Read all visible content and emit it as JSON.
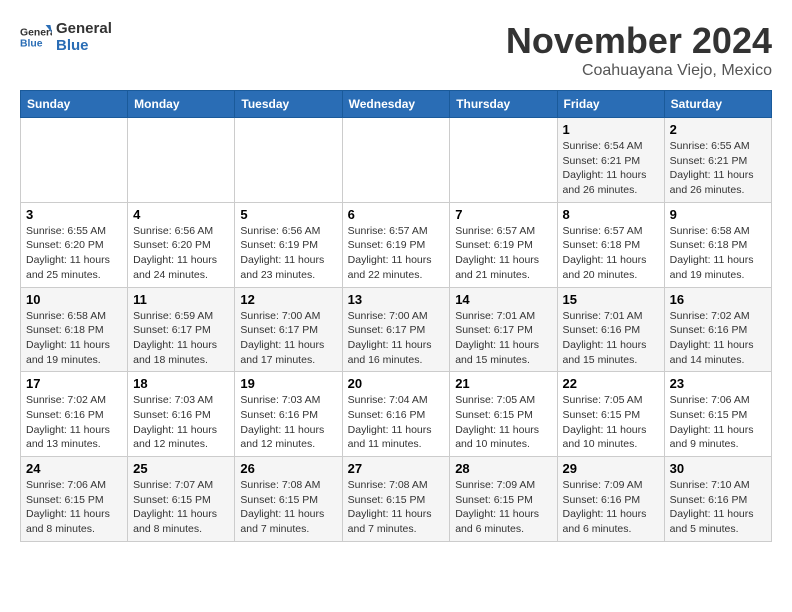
{
  "header": {
    "logo_general": "General",
    "logo_blue": "Blue",
    "month": "November 2024",
    "location": "Coahuayana Viejo, Mexico"
  },
  "weekdays": [
    "Sunday",
    "Monday",
    "Tuesday",
    "Wednesday",
    "Thursday",
    "Friday",
    "Saturday"
  ],
  "weeks": [
    [
      {
        "day": "",
        "info": ""
      },
      {
        "day": "",
        "info": ""
      },
      {
        "day": "",
        "info": ""
      },
      {
        "day": "",
        "info": ""
      },
      {
        "day": "",
        "info": ""
      },
      {
        "day": "1",
        "info": "Sunrise: 6:54 AM\nSunset: 6:21 PM\nDaylight: 11 hours\nand 26 minutes."
      },
      {
        "day": "2",
        "info": "Sunrise: 6:55 AM\nSunset: 6:21 PM\nDaylight: 11 hours\nand 26 minutes."
      }
    ],
    [
      {
        "day": "3",
        "info": "Sunrise: 6:55 AM\nSunset: 6:20 PM\nDaylight: 11 hours\nand 25 minutes."
      },
      {
        "day": "4",
        "info": "Sunrise: 6:56 AM\nSunset: 6:20 PM\nDaylight: 11 hours\nand 24 minutes."
      },
      {
        "day": "5",
        "info": "Sunrise: 6:56 AM\nSunset: 6:19 PM\nDaylight: 11 hours\nand 23 minutes."
      },
      {
        "day": "6",
        "info": "Sunrise: 6:57 AM\nSunset: 6:19 PM\nDaylight: 11 hours\nand 22 minutes."
      },
      {
        "day": "7",
        "info": "Sunrise: 6:57 AM\nSunset: 6:19 PM\nDaylight: 11 hours\nand 21 minutes."
      },
      {
        "day": "8",
        "info": "Sunrise: 6:57 AM\nSunset: 6:18 PM\nDaylight: 11 hours\nand 20 minutes."
      },
      {
        "day": "9",
        "info": "Sunrise: 6:58 AM\nSunset: 6:18 PM\nDaylight: 11 hours\nand 19 minutes."
      }
    ],
    [
      {
        "day": "10",
        "info": "Sunrise: 6:58 AM\nSunset: 6:18 PM\nDaylight: 11 hours\nand 19 minutes."
      },
      {
        "day": "11",
        "info": "Sunrise: 6:59 AM\nSunset: 6:17 PM\nDaylight: 11 hours\nand 18 minutes."
      },
      {
        "day": "12",
        "info": "Sunrise: 7:00 AM\nSunset: 6:17 PM\nDaylight: 11 hours\nand 17 minutes."
      },
      {
        "day": "13",
        "info": "Sunrise: 7:00 AM\nSunset: 6:17 PM\nDaylight: 11 hours\nand 16 minutes."
      },
      {
        "day": "14",
        "info": "Sunrise: 7:01 AM\nSunset: 6:17 PM\nDaylight: 11 hours\nand 15 minutes."
      },
      {
        "day": "15",
        "info": "Sunrise: 7:01 AM\nSunset: 6:16 PM\nDaylight: 11 hours\nand 15 minutes."
      },
      {
        "day": "16",
        "info": "Sunrise: 7:02 AM\nSunset: 6:16 PM\nDaylight: 11 hours\nand 14 minutes."
      }
    ],
    [
      {
        "day": "17",
        "info": "Sunrise: 7:02 AM\nSunset: 6:16 PM\nDaylight: 11 hours\nand 13 minutes."
      },
      {
        "day": "18",
        "info": "Sunrise: 7:03 AM\nSunset: 6:16 PM\nDaylight: 11 hours\nand 12 minutes."
      },
      {
        "day": "19",
        "info": "Sunrise: 7:03 AM\nSunset: 6:16 PM\nDaylight: 11 hours\nand 12 minutes."
      },
      {
        "day": "20",
        "info": "Sunrise: 7:04 AM\nSunset: 6:16 PM\nDaylight: 11 hours\nand 11 minutes."
      },
      {
        "day": "21",
        "info": "Sunrise: 7:05 AM\nSunset: 6:15 PM\nDaylight: 11 hours\nand 10 minutes."
      },
      {
        "day": "22",
        "info": "Sunrise: 7:05 AM\nSunset: 6:15 PM\nDaylight: 11 hours\nand 10 minutes."
      },
      {
        "day": "23",
        "info": "Sunrise: 7:06 AM\nSunset: 6:15 PM\nDaylight: 11 hours\nand 9 minutes."
      }
    ],
    [
      {
        "day": "24",
        "info": "Sunrise: 7:06 AM\nSunset: 6:15 PM\nDaylight: 11 hours\nand 8 minutes."
      },
      {
        "day": "25",
        "info": "Sunrise: 7:07 AM\nSunset: 6:15 PM\nDaylight: 11 hours\nand 8 minutes."
      },
      {
        "day": "26",
        "info": "Sunrise: 7:08 AM\nSunset: 6:15 PM\nDaylight: 11 hours\nand 7 minutes."
      },
      {
        "day": "27",
        "info": "Sunrise: 7:08 AM\nSunset: 6:15 PM\nDaylight: 11 hours\nand 7 minutes."
      },
      {
        "day": "28",
        "info": "Sunrise: 7:09 AM\nSunset: 6:15 PM\nDaylight: 11 hours\nand 6 minutes."
      },
      {
        "day": "29",
        "info": "Sunrise: 7:09 AM\nSunset: 6:16 PM\nDaylight: 11 hours\nand 6 minutes."
      },
      {
        "day": "30",
        "info": "Sunrise: 7:10 AM\nSunset: 6:16 PM\nDaylight: 11 hours\nand 5 minutes."
      }
    ]
  ]
}
